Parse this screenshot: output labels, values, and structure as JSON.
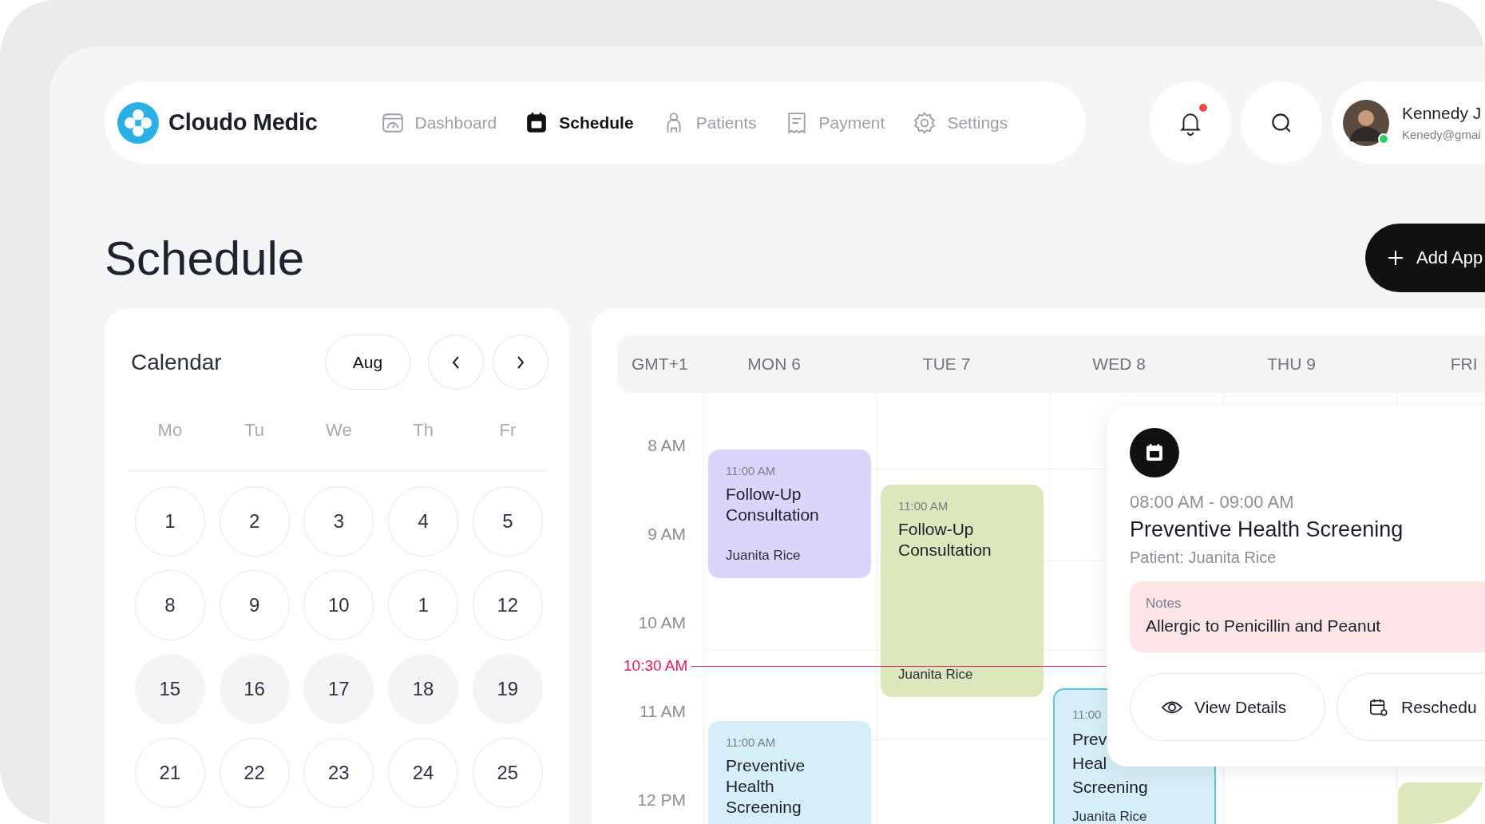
{
  "app": {
    "name": "Cloudo Medic"
  },
  "nav": [
    {
      "label": "Dashboard",
      "selected": false
    },
    {
      "label": "Schedule",
      "selected": true
    },
    {
      "label": "Patients",
      "selected": false
    },
    {
      "label": "Payment",
      "selected": false
    },
    {
      "label": "Settings",
      "selected": false
    }
  ],
  "notifications": {
    "unread": true
  },
  "user": {
    "name": "Kennedy J",
    "email": "Kenedy@gmai",
    "online": true
  },
  "page_title": "Schedule",
  "add_button": {
    "label": "Add App"
  },
  "calendar": {
    "title": "Calendar",
    "month": "Aug",
    "weekdays": [
      "Mo",
      "Tu",
      "We",
      "Th",
      "Fr"
    ],
    "weeks": [
      [
        {
          "day": "1",
          "highlighted": false
        },
        {
          "day": "2",
          "highlighted": false
        },
        {
          "day": "3",
          "highlighted": false
        },
        {
          "day": "4",
          "highlighted": false
        },
        {
          "day": "5",
          "highlighted": false
        }
      ],
      [
        {
          "day": "8",
          "highlighted": false
        },
        {
          "day": "9",
          "highlighted": false
        },
        {
          "day": "10",
          "highlighted": false
        },
        {
          "day": "1",
          "highlighted": false
        },
        {
          "day": "12",
          "highlighted": false
        }
      ],
      [
        {
          "day": "15",
          "highlighted": true
        },
        {
          "day": "16",
          "highlighted": true
        },
        {
          "day": "17",
          "highlighted": true
        },
        {
          "day": "18",
          "highlighted": true
        },
        {
          "day": "19",
          "highlighted": true
        }
      ],
      [
        {
          "day": "21",
          "highlighted": false
        },
        {
          "day": "22",
          "highlighted": false
        },
        {
          "day": "23",
          "highlighted": false
        },
        {
          "day": "24",
          "highlighted": false
        },
        {
          "day": "25",
          "highlighted": false
        }
      ]
    ]
  },
  "week_view": {
    "timezone": "GMT+1",
    "days": [
      "MON 6",
      "TUE 7",
      "WED 8",
      "THU 9",
      "FRI"
    ],
    "hours": [
      "8 AM",
      "9 AM",
      "10 AM",
      "11 AM",
      "12 PM"
    ],
    "now": {
      "label": "10:30 AM"
    },
    "events": [
      {
        "time": "11:00 AM",
        "title_lines": [
          "Follow-Up",
          "Consultation"
        ],
        "patient": "Juanita Rice",
        "color": "#dcd4fb",
        "selected": false
      },
      {
        "time": "11:00 AM",
        "title_lines": [
          "Follow-Up",
          "Consultation"
        ],
        "patient": "Juanita Rice",
        "color": "#dce8bb",
        "selected": false
      },
      {
        "time": "11:00 AM",
        "title_lines": [
          "Preventive",
          "Health",
          "Screening"
        ],
        "color": "#d6eef7",
        "selected": false
      },
      {
        "time": "11:00",
        "title_lines": [
          "Prev",
          "Heal",
          "Screening"
        ],
        "patient": "Juanita Rice",
        "color": "#d6eef7",
        "selected": true
      },
      {
        "color": "#dce8bb",
        "selected": false
      }
    ]
  },
  "popup": {
    "time": "08:00 AM - 09:00 AM",
    "title": "Preventive Health Screening",
    "patient": "Patient: Juanita Rice",
    "notes_label": "Notes",
    "notes": "Allergic to Penicillin and Peanut",
    "actions": [
      "View Details",
      "Reschedu"
    ]
  }
}
